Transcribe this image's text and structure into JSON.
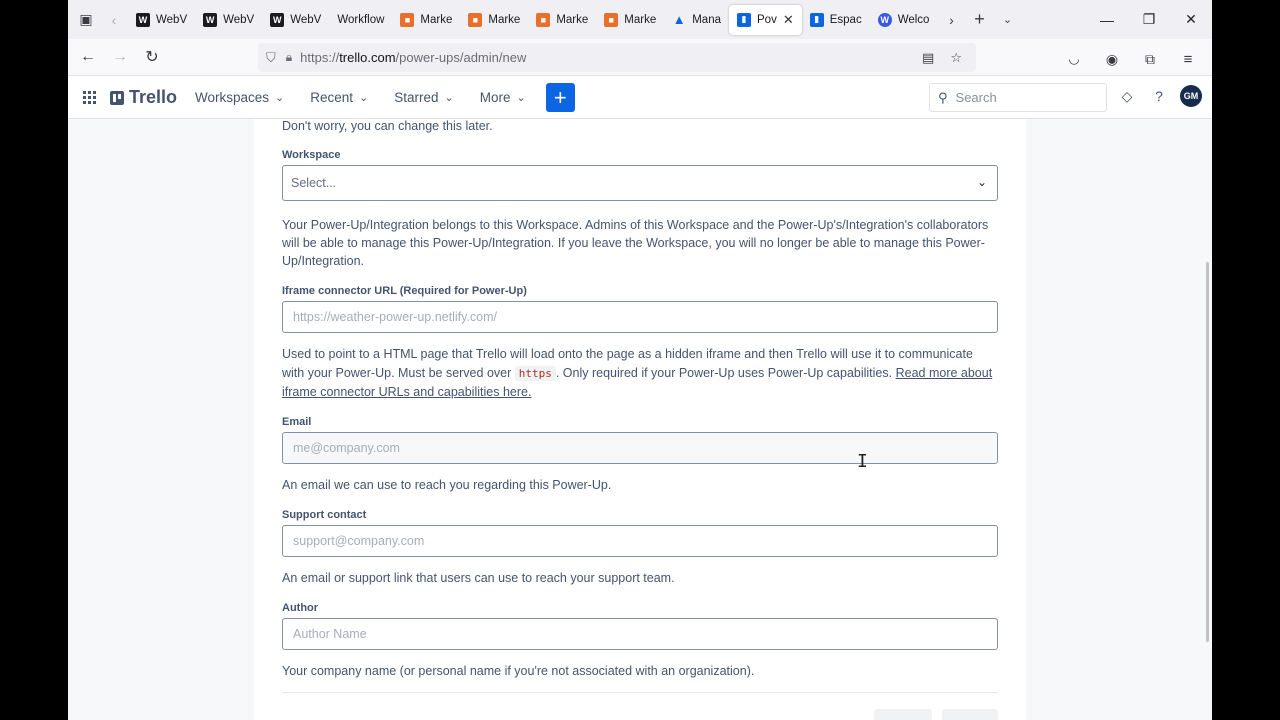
{
  "browser": {
    "tabs": [
      {
        "label": "WebV",
        "icon": "webflow-icon"
      },
      {
        "label": "WebV",
        "icon": "webflow-icon"
      },
      {
        "label": "WebV",
        "icon": "webflow-icon"
      },
      {
        "label": "Workflow",
        "icon": "none"
      },
      {
        "label": "Marke",
        "icon": "shopping-bag-icon"
      },
      {
        "label": "Marke",
        "icon": "shopping-bag-icon"
      },
      {
        "label": "Marke",
        "icon": "shopping-bag-icon"
      },
      {
        "label": "Marke",
        "icon": "shopping-bag-icon"
      },
      {
        "label": "Mana",
        "icon": "atlassian-icon"
      },
      {
        "label": "Pov",
        "icon": "trello-icon"
      },
      {
        "label": "Espac",
        "icon": "trello-icon"
      },
      {
        "label": "Welco",
        "icon": "wordpress-icon"
      }
    ],
    "url_prefix": "https://",
    "url_domain": "trello.com",
    "url_path": "/power-ups/admin/new"
  },
  "trello_header": {
    "logo": "Trello",
    "menus": [
      "Workspaces",
      "Recent",
      "Starred",
      "More"
    ],
    "create_label": "+",
    "search_placeholder": "Search",
    "avatar_initials": "GM"
  },
  "form": {
    "intro_note": "Don't worry, you can change this later.",
    "workspace": {
      "label": "Workspace",
      "value": "Select...",
      "help": "Your Power-Up/Integration belongs to this Workspace. Admins of this Workspace and the Power-Up's/Integration's collaborators will be able to manage this Power-Up/Integration. If you leave the Workspace, you will no longer be able to manage this Power-Up/Integration."
    },
    "iframe": {
      "label": "Iframe connector URL (Required for Power-Up)",
      "placeholder": "https://weather-power-up.netlify.com/",
      "help_a": "Used to point to a HTML page that Trello will load onto the page as a hidden iframe and then Trello will use it to communicate with your Power-Up. Must be served over ",
      "help_code": "https",
      "help_b": ". Only required if your Power-Up uses Power-Up capabilities. ",
      "help_link": "Read more about iframe connector URLs and capabilities here."
    },
    "email": {
      "label": "Email",
      "placeholder": "me@company.com",
      "help": "An email we can use to reach you regarding this Power-Up."
    },
    "support": {
      "label": "Support contact",
      "placeholder": "support@company.com",
      "help": "An email or support link that users can use to reach your support team."
    },
    "author": {
      "label": "Author",
      "placeholder": "Author Name",
      "help": "Your company name (or personal name if you're not associated with an organization)."
    }
  }
}
